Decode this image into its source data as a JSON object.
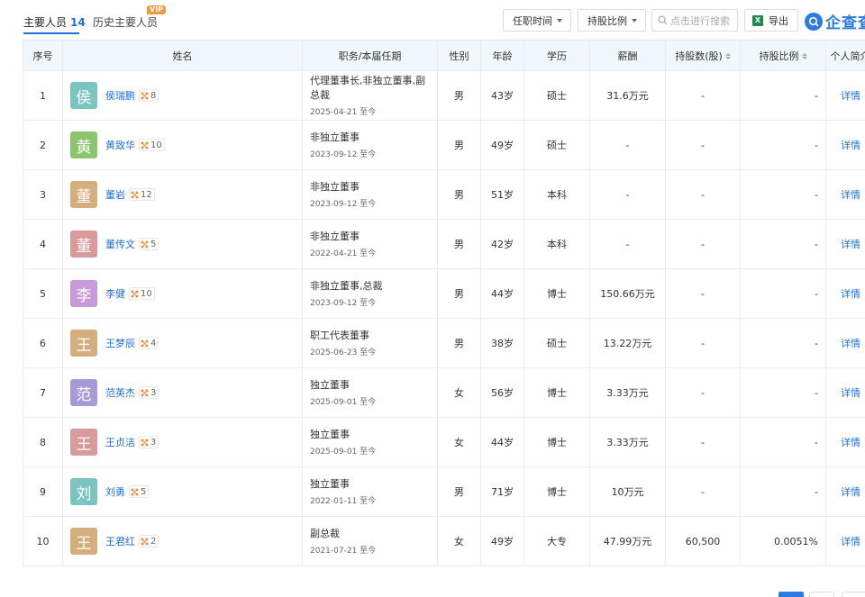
{
  "tabs": {
    "active_label": "主要人员",
    "active_count": "14",
    "history_label": "历史主要人员",
    "vip": "VIP"
  },
  "toolbar": {
    "tenure_filter": "任职时间",
    "holding_filter": "持股比例",
    "search_placeholder": "点击进行搜索",
    "export_label": "导出",
    "xls_mark": "X",
    "logo_text": "企查查"
  },
  "table": {
    "headers": {
      "index": "序号",
      "name": "姓名",
      "position": "职务/本届任期",
      "gender": "性别",
      "age": "年龄",
      "education": "学历",
      "salary": "薪酬",
      "shares": "持股数(股)",
      "ratio": "持股比例",
      "profile": "个人简介"
    },
    "rows": [
      {
        "index": "1",
        "avatar_char": "侯",
        "avatar_color": "#7CC4C0",
        "name": "侯瑞鹏",
        "rel": "8",
        "position": "代理董事长,非独立董事,副总裁",
        "date": "2025-04-21 至今",
        "gender": "男",
        "age": "43岁",
        "education": "硕士",
        "salary": "31.6万元",
        "shares": "-",
        "ratio": "-",
        "detail": "详情"
      },
      {
        "index": "2",
        "avatar_char": "黄",
        "avatar_color": "#8DC46E",
        "name": "黄致华",
        "rel": "10",
        "position": "非独立董事",
        "date": "2023-09-12 至今",
        "gender": "男",
        "age": "49岁",
        "education": "硕士",
        "salary": "-",
        "shares": "-",
        "ratio": "-",
        "detail": "详情"
      },
      {
        "index": "3",
        "avatar_char": "董",
        "avatar_color": "#D4AE7C",
        "name": "董岩",
        "rel": "12",
        "position": "非独立董事",
        "date": "2023-09-12 至今",
        "gender": "男",
        "age": "51岁",
        "education": "本科",
        "salary": "-",
        "shares": "-",
        "ratio": "-",
        "detail": "详情"
      },
      {
        "index": "4",
        "avatar_char": "董",
        "avatar_color": "#D89A9A",
        "name": "董传文",
        "rel": "5",
        "position": "非独立董事",
        "date": "2022-04-21 至今",
        "gender": "男",
        "age": "42岁",
        "education": "本科",
        "salary": "-",
        "shares": "-",
        "ratio": "-",
        "detail": "详情"
      },
      {
        "index": "5",
        "avatar_char": "李",
        "avatar_color": "#C89AD8",
        "name": "李健",
        "rel": "10",
        "position": "非独立董事,总裁",
        "date": "2023-09-12 至今",
        "gender": "男",
        "age": "44岁",
        "education": "博士",
        "salary": "150.66万元",
        "shares": "-",
        "ratio": "-",
        "detail": "详情"
      },
      {
        "index": "6",
        "avatar_char": "王",
        "avatar_color": "#D4AE7C",
        "name": "王梦辰",
        "rel": "4",
        "position": "职工代表董事",
        "date": "2025-06-23 至今",
        "gender": "男",
        "age": "38岁",
        "education": "硕士",
        "salary": "13.22万元",
        "shares": "-",
        "ratio": "-",
        "detail": "详情"
      },
      {
        "index": "7",
        "avatar_char": "范",
        "avatar_color": "#A89AD8",
        "name": "范英杰",
        "rel": "3",
        "position": "独立董事",
        "date": "2025-09-01 至今",
        "gender": "女",
        "age": "56岁",
        "education": "博士",
        "salary": "3.33万元",
        "shares": "-",
        "ratio": "-",
        "detail": "详情"
      },
      {
        "index": "8",
        "avatar_char": "王",
        "avatar_color": "#D89A9A",
        "name": "王贞洁",
        "rel": "3",
        "position": "独立董事",
        "date": "2025-09-01 至今",
        "gender": "女",
        "age": "44岁",
        "education": "博士",
        "salary": "3.33万元",
        "shares": "-",
        "ratio": "-",
        "detail": "详情"
      },
      {
        "index": "9",
        "avatar_char": "刘",
        "avatar_color": "#7CC4C0",
        "name": "刘勇",
        "rel": "5",
        "position": "独立董事",
        "date": "2022-01-11 至今",
        "gender": "男",
        "age": "71岁",
        "education": "博士",
        "salary": "10万元",
        "shares": "-",
        "ratio": "-",
        "detail": "详情"
      },
      {
        "index": "10",
        "avatar_char": "王",
        "avatar_color": "#D4AE7C",
        "name": "王君红",
        "rel": "2",
        "position": "副总裁",
        "date": "2021-07-21 至今",
        "gender": "女",
        "age": "49岁",
        "education": "大专",
        "salary": "47.99万元",
        "shares": "60,500",
        "ratio": "0.0051%",
        "detail": "详情"
      }
    ]
  }
}
